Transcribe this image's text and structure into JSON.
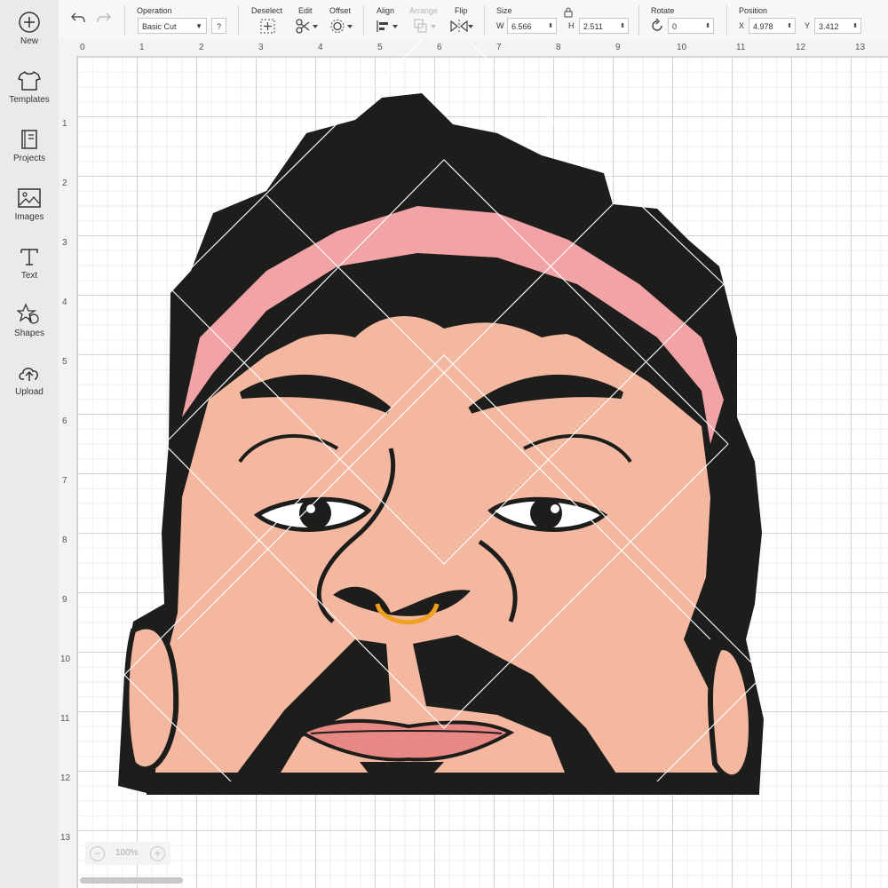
{
  "sidebar": {
    "items": [
      {
        "label": "New",
        "icon": "plus-circle-icon"
      },
      {
        "label": "Templates",
        "icon": "shirt-icon"
      },
      {
        "label": "Projects",
        "icon": "book-icon"
      },
      {
        "label": "Images",
        "icon": "image-icon"
      },
      {
        "label": "Text",
        "icon": "text-t-icon"
      },
      {
        "label": "Shapes",
        "icon": "shapes-icon"
      },
      {
        "label": "Upload",
        "icon": "cloud-upload-icon"
      }
    ]
  },
  "toolbar": {
    "operation_label": "Operation",
    "operation_value": "Basic Cut",
    "help": "?",
    "deselect_label": "Deselect",
    "edit_label": "Edit",
    "offset_label": "Offset",
    "align_label": "Align",
    "arrange_label": "Arrange",
    "flip_label": "Flip",
    "size_label": "Size",
    "w_label": "W",
    "w_value": "6.566",
    "h_label": "H",
    "h_value": "2.511",
    "rotate_label": "Rotate",
    "rotate_value": "0",
    "position_label": "Position",
    "x_label": "X",
    "x_value": "4.978",
    "y_label": "Y",
    "y_value": "3.412"
  },
  "ruler": {
    "top": [
      "0",
      "1",
      "2",
      "3",
      "4",
      "5",
      "6",
      "7",
      "8",
      "9",
      "10",
      "11",
      "12",
      "13"
    ],
    "left": [
      "1",
      "2",
      "3",
      "4",
      "5",
      "6",
      "7",
      "8",
      "9",
      "10",
      "11",
      "12",
      "13"
    ]
  },
  "zoom": {
    "value": "100%",
    "minus": "−",
    "plus": "+"
  },
  "colors": {
    "skin": "#f4b8a0",
    "hair": "#1d1d1b",
    "headband": "#f2a3a6",
    "nose_ring": "#f0a020",
    "lips": "#e88884",
    "accent": "#1aa34a"
  }
}
